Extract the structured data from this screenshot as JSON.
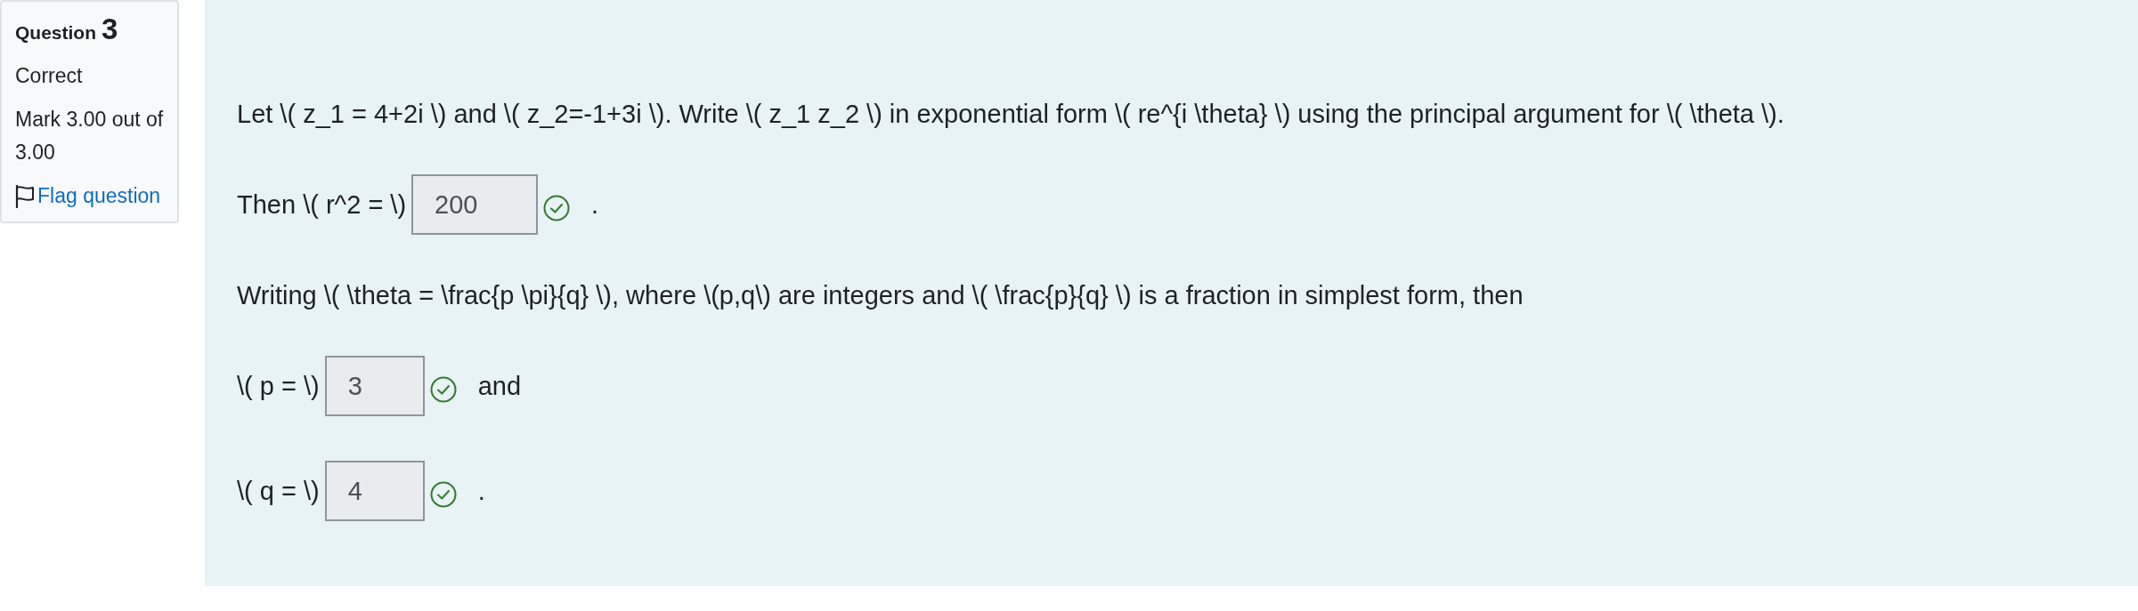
{
  "question_info": {
    "label": "Question",
    "number": "3",
    "state": "Correct",
    "mark": "Mark 3.00 out of 3.00",
    "flag": {
      "label": "Flag question",
      "flagged": false
    }
  },
  "question": {
    "rows": [
      {
        "kind": "text",
        "text": "Let \\( z_1 = 4+2i \\) and \\( z_2=-1+3i \\). Write \\( z_1 z_2 \\) in exponential form \\( re^{i \\theta} \\) using the principal argument for \\( \\theta \\)."
      },
      {
        "kind": "answer",
        "label": "Then \\( r^2 = \\)",
        "value": "200",
        "readonly": true,
        "correct": true,
        "suffix": "."
      },
      {
        "kind": "text",
        "text": "Writing \\( \\theta = \\frac{p \\pi}{q} \\), where \\(p,q\\) are integers and \\( \\frac{p}{q} \\) is a fraction in simplest form, then"
      },
      {
        "kind": "answer",
        "label": "\\( p = \\)",
        "value": "3",
        "readonly": true,
        "correct": true,
        "suffix": "and"
      },
      {
        "kind": "answer",
        "label": "\\( q = \\)",
        "value": "4",
        "readonly": true,
        "correct": true,
        "suffix": "."
      }
    ]
  }
}
